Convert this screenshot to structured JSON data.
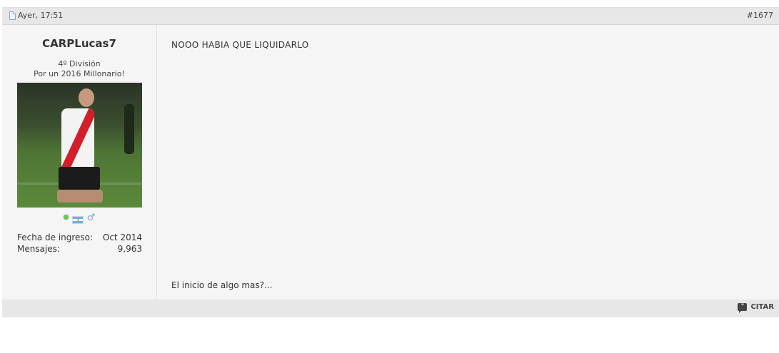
{
  "post": {
    "date": "Ayer, 17:51",
    "number": "#1677",
    "message": "NOOO HABIA QUE LIQUIDARLO",
    "signature": "El inicio de algo mas?...",
    "quote_label": "CITAR"
  },
  "user": {
    "name": "CARPLucas7",
    "rank": "4º División",
    "title": "Por un 2016 Millonario!",
    "stats": [
      {
        "label": "Fecha de ingreso:",
        "value": "Oct 2014"
      },
      {
        "label": "Mensajes:",
        "value": "9,963"
      }
    ],
    "icons": [
      "online-icon",
      "argentina-flag-icon",
      "male-icon"
    ]
  },
  "colors": {
    "header_bg": "#e7e7e7",
    "body_bg": "#f5f5f5",
    "online": "#71c35b"
  }
}
